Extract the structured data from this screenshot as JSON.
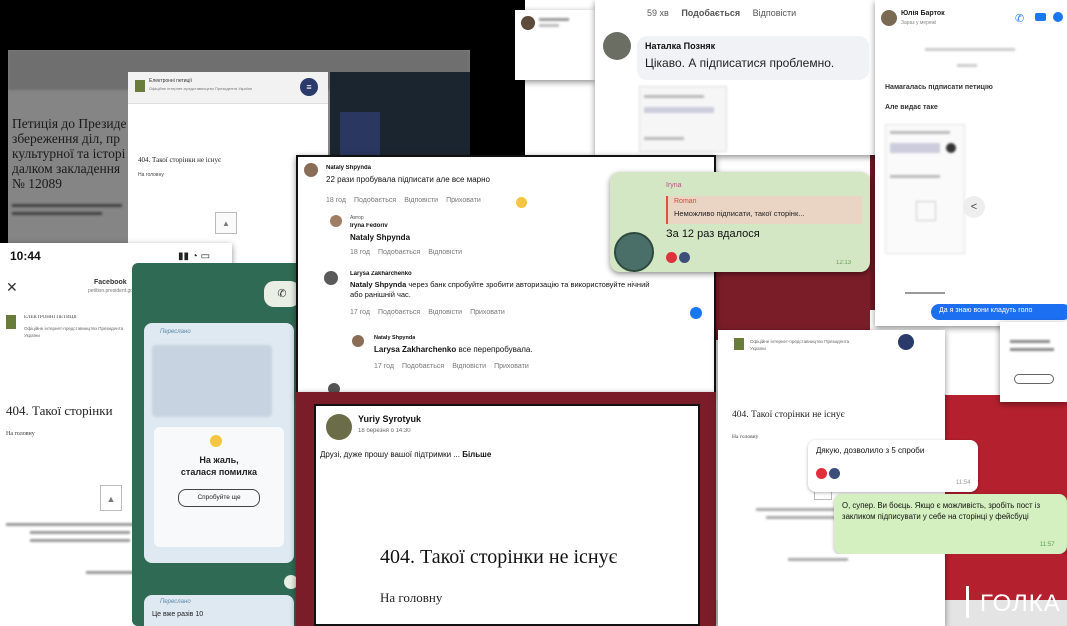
{
  "bg_colors": {
    "black": "#000000",
    "maroon": "#7d1f2a",
    "green": "#2e6a54",
    "red": "#b5202e",
    "grey": "#dcdcdc"
  },
  "petition_bw": {
    "header_title": "Електронні петиції",
    "header_sub": "Офіційне інтернет-представництво Президента України",
    "title_lines": [
      "Петиція до Президе",
      "збереження діл, пр",
      "культурної та історі",
      "далком закладення",
      "№ 12089"
    ],
    "notfound": "404. Такої сторінки не існує",
    "home": "На головну"
  },
  "fb_top": {
    "count": "59 хв",
    "like": "Подобається",
    "reply": "Відповісти",
    "name": "Наталка Позняк",
    "text": "Цікаво. А підписатися проблемно."
  },
  "messenger_top": {
    "name": "Юлія Барток",
    "status": "Зараз у мережі",
    "line1": "Намагалась підписати петицію",
    "line2": "Але видає таке",
    "bubble": "Да я знаю вони кладуть голо"
  },
  "phone_left": {
    "time": "10:44",
    "app": "Facebook",
    "url": "petition.president.gov.ua",
    "org": "ЕЛЕКТРОННІ ПЕТИЦІЇ",
    "org_sub": "Офіційне інтернет-представництво Президента України",
    "notfound": "404. Такої сторінки",
    "home": "На головну"
  },
  "green_chat": {
    "forward": "Переслано",
    "error_line1": "На жаль,",
    "error_line2": "сталася помилка",
    "retry": "Спробуйте ще",
    "forward2": "Переслано",
    "bottom": "Це вже разів 10"
  },
  "fb_comments": {
    "c1_name": "Nataly Shpynda",
    "c1_text": "22 рази пробувала підписати але все марно",
    "c1_time": "18 год",
    "like": "Подобається",
    "reply": "Відповісти",
    "translate": "Приховати",
    "c2_author": "Автор",
    "c2_name": "Iryna Fedoriv",
    "c2_tag": "Nataly Shpynda",
    "c3_name": "Larysa Zakharchenko",
    "c3_tag": "Nataly Shpynda",
    "c3_text": "через банк спробуйте зробити авторизацію та використовуйте нічний або ранішній час.",
    "c3_time": "17 год",
    "c4_name": "Nataly Shpynda",
    "c4_tag": "Larysa Zakharchenko",
    "c4_text": "все перепробувала.",
    "c4_time": "17 год"
  },
  "tg_top": {
    "sender": "Iryna",
    "quote_name": "Roman",
    "quote_text": "Неможливо підписати, такої сторінк...",
    "text": "За 12 раз вдалося",
    "time": "12:13"
  },
  "fb_post": {
    "name": "Yuriy Syrotyuk",
    "date": "18 березня о 14:30",
    "text": "Друзі, дуже прошу вашої підтримки ...",
    "more": "Більше",
    "notfound": "404. Такої сторінки не існує",
    "home": "На головну"
  },
  "petition_right": {
    "org_sub": "Офіційне інтернет-представництво Президента України",
    "notfound": "404. Такої сторінки не існує",
    "home": "На головну"
  },
  "tg_bottom": {
    "msg1": "Дякую, дозволило з 5 спроби",
    "time1": "11:54",
    "msg2": "О, супер. Ви боєць. Якщо є можливість, зробіть пост із закликом підписувати у себе на сторінці у фейсбуці",
    "time2": "11:57"
  },
  "brand": {
    "logo_text": "ГОЛКА"
  }
}
